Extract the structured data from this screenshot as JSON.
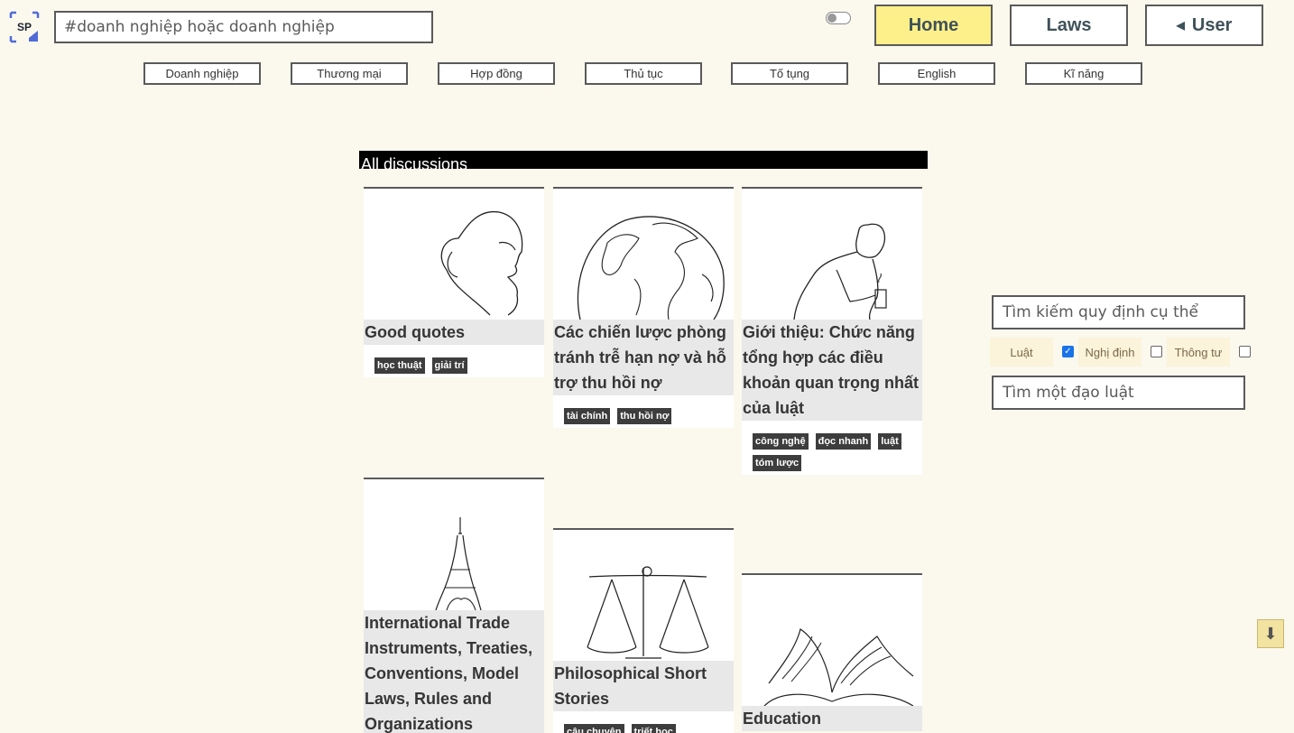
{
  "header": {
    "logo_text": "SP",
    "search_placeholder": "#doanh nghiệp hoặc doanh nghiệp",
    "nav": {
      "home": "Home",
      "laws": "Laws",
      "user": "User"
    }
  },
  "categories": [
    "Doanh nghiệp",
    "Thương mại",
    "Hợp đồng",
    "Thủ tục",
    "Tố tụng",
    "English",
    "Kĩ năng"
  ],
  "discussions": {
    "heading": "All discussions",
    "cards": [
      {
        "title": "Good quotes",
        "image": "face-line-art",
        "tags": [
          "học thuật",
          "giải trí"
        ]
      },
      {
        "title": "Các chiến lược phòng tránh trễ hạn nợ và hỗ trợ thu hồi nợ",
        "image": "globe-line-art",
        "tags": [
          "tài chính",
          "thu hồi nợ"
        ]
      },
      {
        "title": "Giới thiệu: Chức năng tổng hợp các điều khoản quan trọng nhất của luật",
        "image": "man-coffee-line-art",
        "tags": [
          "công nghệ",
          "đọc nhanh",
          "luật",
          "tóm lược"
        ]
      },
      {
        "title": "International Trade Instruments, Treaties, Conventions, Model Laws, Rules and Organizations",
        "image": "eiffel-tower-line-art",
        "tags": []
      },
      {
        "title": "Philosophical Short Stories",
        "image": "scales-line-art",
        "tags": [
          "câu chuyện",
          "triết học"
        ]
      },
      {
        "title": "Education",
        "image": "open-book-line-art",
        "tags": []
      }
    ]
  },
  "sidebar": {
    "regulation_search_placeholder": "Tìm kiếm quy định cụ thể",
    "law_search_placeholder": "Tìm một đạo luật",
    "filters": [
      {
        "label": "Luật",
        "checked": true
      },
      {
        "label": "Nghị định",
        "checked": false
      },
      {
        "label": "Thông tư",
        "checked": false
      }
    ]
  },
  "icons": {
    "user_caret": "caret-left-icon",
    "scroll": "arrow-down-icon"
  },
  "colors": {
    "page_bg": "#fbf9ee",
    "home_active": "#fdef8a",
    "tag_bg": "#3d3d3d",
    "title_bg": "#e8e8e8",
    "logo_blue": "#4f6bd8"
  }
}
